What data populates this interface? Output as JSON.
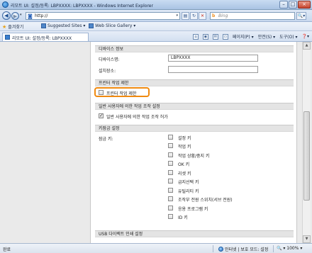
{
  "window": {
    "title": "리모트 UI: 설정/등록: LBPXXXX: LBPXXXX - Windows Internet Explorer",
    "min": "–",
    "max": "□",
    "close": "×"
  },
  "addressbar": {
    "url": "http://",
    "search_engine": "b",
    "search_placeholder": "Bing",
    "back": "◀",
    "forward": "▶",
    "refresh": "↻",
    "stop": "✕",
    "search_go": "🔍▾"
  },
  "favorites": {
    "label": "즐겨찾기",
    "items": [
      "Suggested Sites ▾",
      "Web Slice Gallery ▾"
    ]
  },
  "tab": {
    "label": "리모트 UI: 설정/등록: LBPXXXX"
  },
  "commandbar": {
    "page": "페이지(P) ▾",
    "safety": "안전(S) ▾",
    "tools": "도구(O) ▾",
    "help": "❓▾"
  },
  "device_info": {
    "header": "디바이스 정보",
    "name_label": "디바이스명:",
    "name_value": "LBPXXXX",
    "location_label": "설치장소:",
    "location_value": ""
  },
  "printer_restriction": {
    "header": "프린터 작업 제한",
    "checkbox_label": "프린터 작업 제한",
    "checked": false
  },
  "general_user": {
    "header": "일반 사용자에 의한 작업 조작 설정",
    "checkbox_label": "일반 사용자에 의한 작업 조작 허가",
    "checked": true
  },
  "key_lock": {
    "header": "키잠금 설정",
    "label": "잠금 키:",
    "keys": [
      {
        "label": "설정 키",
        "checked": false
      },
      {
        "label": "작업 키",
        "checked": false
      },
      {
        "label": "작업 상황/중지 키",
        "checked": false
      },
      {
        "label": "OK 키",
        "checked": false
      },
      {
        "label": "리셋 키",
        "checked": false
      },
      {
        "label": "급지선택 키",
        "checked": false
      },
      {
        "label": "유틸리티 키",
        "checked": false
      },
      {
        "label": "조작부 전원 스위치(서브 전원)",
        "checked": false
      },
      {
        "label": "응용 프로그램 키",
        "checked": false
      },
      {
        "label": "ID 키",
        "checked": false
      }
    ]
  },
  "usb": {
    "header": "USB 다이렉트 인쇄 설정"
  },
  "status": {
    "text": "완료",
    "zone": "인터넷 | 보호 모드: 설정",
    "zoom": "🔍 ▾ 100% ▾"
  }
}
